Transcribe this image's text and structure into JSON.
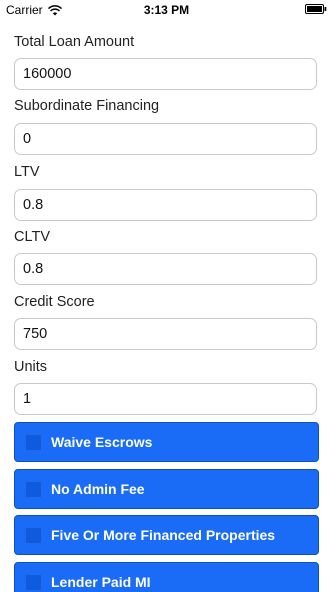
{
  "status_bar": {
    "carrier": "Carrier",
    "time": "3:13 PM",
    "wifi_icon": "wifi-icon",
    "battery_icon": "battery-icon"
  },
  "form": {
    "fields": [
      {
        "label": "Total Loan Amount",
        "value": "160000"
      },
      {
        "label": "Subordinate Financing",
        "value": "0"
      },
      {
        "label": "LTV",
        "value": "0.8"
      },
      {
        "label": "CLTV",
        "value": "0.8"
      },
      {
        "label": "Credit Score",
        "value": "750"
      },
      {
        "label": "Units",
        "value": "1"
      }
    ],
    "options": [
      {
        "label": "Waive Escrows",
        "checked": false
      },
      {
        "label": "No Admin Fee",
        "checked": false
      },
      {
        "label": "Five Or More Financed Properties",
        "checked": false
      },
      {
        "label": "Lender Paid MI",
        "checked": false
      }
    ]
  },
  "colors": {
    "button_blue": "#1a6cf7",
    "button_border": "#0d4fc4"
  }
}
